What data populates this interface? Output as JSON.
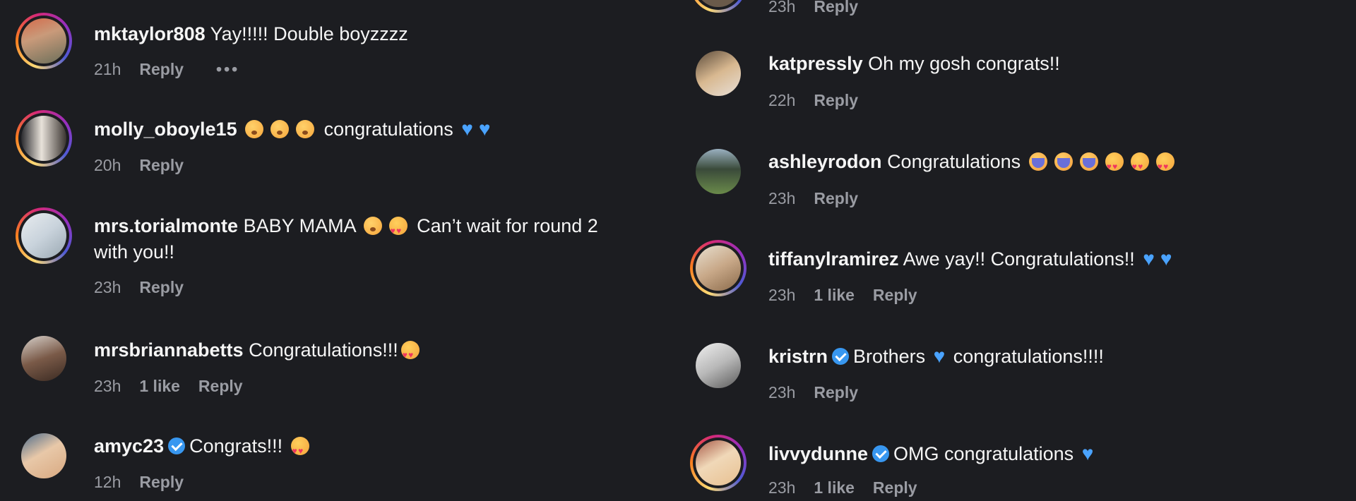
{
  "left_comments": [
    {
      "username": "mktaylor808",
      "text": "Yay!!!!! Double boyzzzz",
      "time": "21h",
      "reply": "Reply",
      "more": "•••"
    },
    {
      "username": "molly_oboyle15",
      "text": "congratulations",
      "time": "20h",
      "reply": "Reply"
    },
    {
      "username": "mrs.torialmonte",
      "text_a": "BABY MAMA",
      "text_b": "Can’t wait for round 2",
      "text_c": "with you!!",
      "time": "23h",
      "reply": "Reply"
    },
    {
      "username": "mrsbriannabetts",
      "text": "Congratulations!!!",
      "time": "23h",
      "likes": "1 like",
      "reply": "Reply"
    },
    {
      "username": "amyc23",
      "text": "Congrats!!!",
      "time": "12h",
      "reply": "Reply"
    }
  ],
  "right_comments": [
    {
      "time": "23h",
      "reply": "Reply"
    },
    {
      "username": "katpressly",
      "text": "Oh my gosh congrats!!",
      "time": "22h",
      "reply": "Reply"
    },
    {
      "username": "ashleyrodon",
      "text": "Congratulations",
      "time": "23h",
      "reply": "Reply"
    },
    {
      "username": "tiffanylramirez",
      "text": "Awe yay!! Congratulations!!",
      "time": "23h",
      "likes": "1 like",
      "reply": "Reply"
    },
    {
      "username": "kristrn",
      "text_a": "Brothers",
      "text_b": "congratulations!!!!",
      "time": "23h",
      "reply": "Reply"
    },
    {
      "username": "livvydunne",
      "text": "OMG congratulations",
      "time": "23h",
      "likes": "1 like",
      "reply": "Reply"
    }
  ],
  "colors": {
    "background": "#1c1d21",
    "meta": "#9a9ca3",
    "verified": "#3897f0",
    "blue_heart": "#4aa3ff"
  }
}
